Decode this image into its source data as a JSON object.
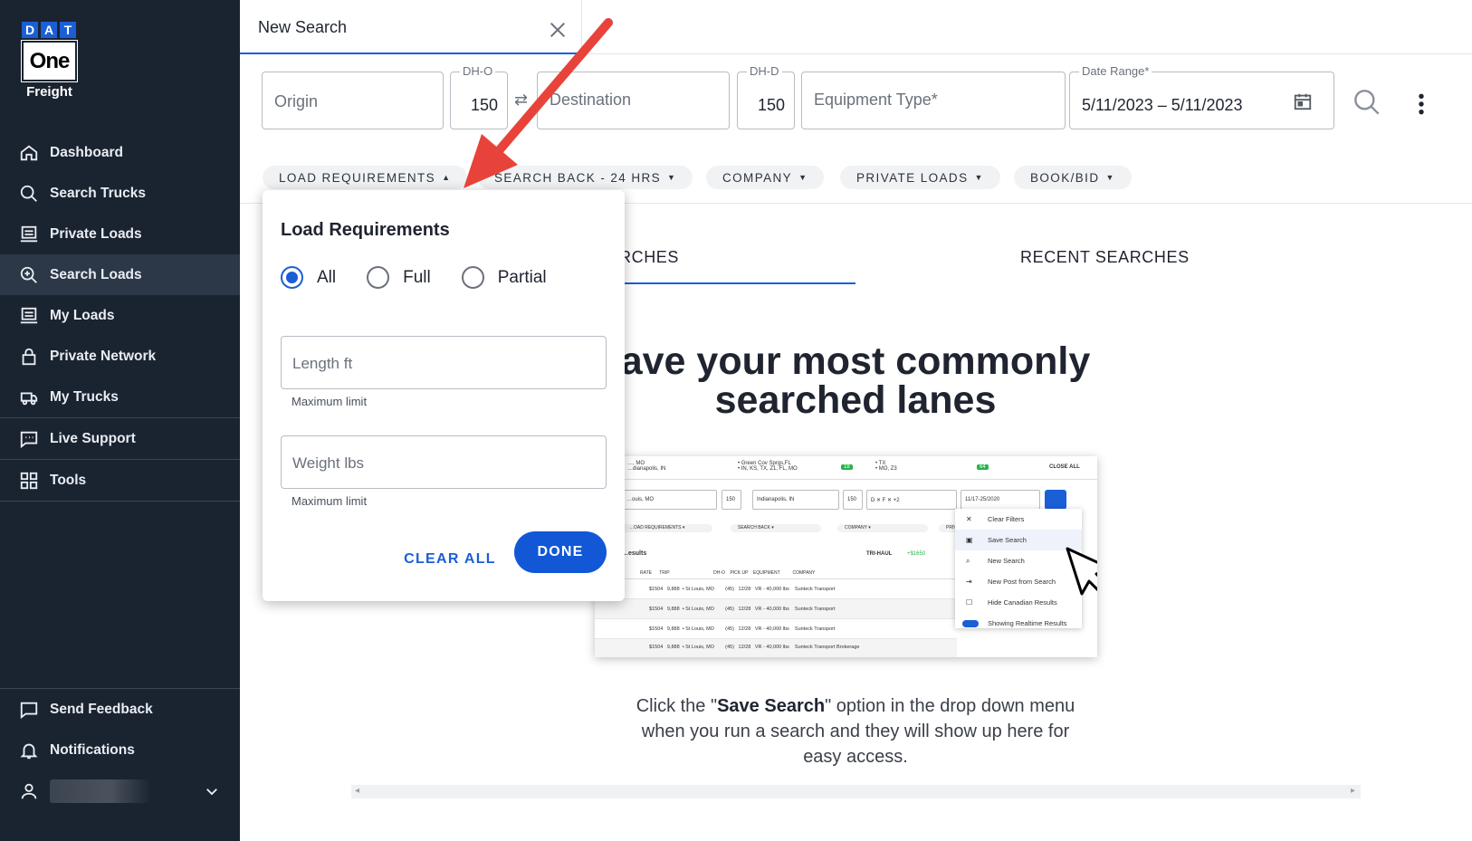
{
  "logo": {
    "letters": [
      "D",
      "A",
      "T"
    ],
    "one": "One",
    "freight": "Freight"
  },
  "sidebar": {
    "items": [
      {
        "label": "Dashboard",
        "icon": "home-icon"
      },
      {
        "label": "Search Trucks",
        "icon": "search-icon"
      },
      {
        "label": "Private Loads",
        "icon": "monitor-icon"
      },
      {
        "label": "Search Loads",
        "icon": "search-plus-icon",
        "active": true
      },
      {
        "label": "My Loads",
        "icon": "monitor-icon"
      },
      {
        "label": "Private Network",
        "icon": "lock-icon"
      },
      {
        "label": "My Trucks",
        "icon": "truck-icon"
      },
      {
        "label": "Live Support",
        "icon": "chat-icon"
      },
      {
        "label": "Tools",
        "icon": "grid-icon"
      }
    ],
    "bottom": [
      {
        "label": "Send Feedback",
        "icon": "feedback-icon"
      },
      {
        "label": "Notifications",
        "icon": "bell-icon"
      }
    ]
  },
  "tab": {
    "title": "New Search"
  },
  "search": {
    "origin_placeholder": "Origin",
    "dho_label": "DH-O",
    "dho_value": "150",
    "destination_placeholder": "Destination",
    "dhd_label": "DH-D",
    "dhd_value": "150",
    "equipment_placeholder": "Equipment Type*",
    "date_label": "Date Range*",
    "date_value": "5/11/2023 – 5/11/2023"
  },
  "filters": [
    "LOAD REQUIREMENTS",
    "SEARCH BACK - 24 HRS",
    "COMPANY",
    "PRIVATE LOADS",
    "BOOK/BID"
  ],
  "saved": {
    "tab_saved": "RCHES",
    "tab_recent": "RECENT SEARCHES",
    "headline_1": "ave your most commonly",
    "headline_2": "searched lanes",
    "desc_pre": "Click the \"",
    "desc_bold": "Save Search",
    "desc_post": "\" option in the drop down menu when you run a search and they will show up here for easy access."
  },
  "preview": {
    "close_all": "CLOSE ALL",
    "tab1_l1": "…, MO",
    "tab1_l2": "…dianapolis, IN",
    "tab2_l1": "• Green Cov Sprgs,FL",
    "tab2_l2": "• IN, KS, TX, Z1, FL, MO",
    "tab2_badge": "18",
    "tab3_l1": "• TX",
    "tab3_l2": "• MO, Z3",
    "tab3_badge": "64",
    "origin": "…ouis, MO",
    "dh1": "150",
    "dest": "Indianapolis, IN",
    "dh2": "150",
    "equip": "D ✕   F ✕   +2",
    "date": "11/17-25/2020",
    "chip1": "…OAD REQUIREMENTS ▾",
    "chip2": "SEARCH BACK ▾",
    "chip3": "COMPANY ▾",
    "chip4": "PRIVA…",
    "results": "…esults",
    "trihaul": "TRI-HAUL",
    "trihaul_amt": "+$1650",
    "headers": "RATE      TRIP                                   DH-O    PICK UP    EQUIPMENT          COMPANY",
    "rows": [
      "$1504   9,888  • St Louis, MO        (45)   12/28   VR - 40,000 lbs    Sunteck Transport",
      "$1504   9,888  • St Louis, MO        (45)   12/28   VR - 40,000 lbs    Sunteck Transport",
      "$1504   9,888  • St Louis, MO        (45)   12/28   VR - 40,000 lbs    Sunteck Transport",
      "$1504   9,888  • St Louis, MO        (45)   12/28   VR - 40,000 lbs    Sunteck Transport Brokerage"
    ],
    "menu": [
      {
        "label": "Clear Filters",
        "icon": "✕"
      },
      {
        "label": "Save Search",
        "icon": "▣"
      },
      {
        "label": "New Search",
        "icon": "⌕"
      },
      {
        "label": "New Post from Search",
        "icon": "⇥"
      },
      {
        "label": "Hide Canadian Results",
        "icon": "☐"
      },
      {
        "label": "Showing Realtime Results",
        "icon": ""
      }
    ]
  },
  "panel": {
    "title": "Load Requirements",
    "radios": [
      {
        "label": "All",
        "selected": true
      },
      {
        "label": "Full",
        "selected": false
      },
      {
        "label": "Partial",
        "selected": false
      }
    ],
    "length_placeholder": "Length ft",
    "length_hint": "Maximum limit",
    "weight_placeholder": "Weight lbs",
    "weight_hint": "Maximum limit",
    "clear_label": "CLEAR ALL",
    "done_label": "DONE"
  },
  "colors": {
    "sidebar_bg": "#1a2330",
    "accent": "#1b5fd6",
    "annotation_arrow": "#e8433a"
  }
}
